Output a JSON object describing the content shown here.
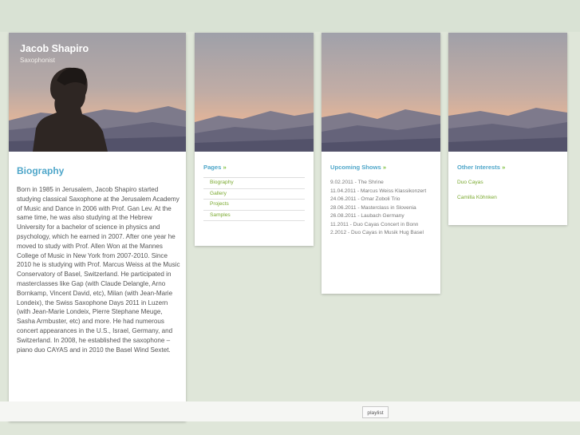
{
  "header": {
    "name": "Jacob Shapiro",
    "role": "Saxophonist"
  },
  "biography": {
    "title": "Biography",
    "text": "Born in 1985 in Jerusalem, Jacob Shapiro started studying classical Saxophone at the Jerusalem Academy of Music and Dance in 2006 with Prof. Gan Lev. At the same time, he was also studying at the Hebrew University for a bachelor of science in physics and psychology, which he earned in 2007. After one year he moved to study with Prof. Allen Won at the Mannes College of Music in New York from 2007-2010. Since 2010 he is studying with Prof. Marcus Weiss at the Music Conservatory of Basel, Switzerland. He participated in masterclasses like Gap (with Claude Delangle, Arno Bornkamp, Vincent David, etc), Milan (with Jean-Marie Londeix), the Swiss Saxophone Days 2011 in Luzern (with Jean-Marie Londeix, Pierre Stephane Meuge, Sasha Armbuster, etc) and more. He had numerous concert appearances in the U.S., Israel, Germany, and Switzerland. In 2008, he established the saxophone – piano duo CAYAS and in 2010 the Basel Wind Sextet."
  },
  "pages": {
    "title": "Pages",
    "arrow": "»",
    "items": [
      "Biography",
      "Gallery",
      "Projects",
      "Samples"
    ]
  },
  "shows": {
    "title": "Upcoming Shows",
    "arrow": "»",
    "items": [
      "9.02.2011 - The Shrine",
      "11.04.2011 - Marcus Weiss Klassikonzert",
      "24.06.2011 - Omar Zoboli Trio",
      "28.06.2011 - Masterclass in Slovenia",
      "26.08.2011 - Laubach Germany",
      "11.2011 - Duo Cayas Concert in Bonn",
      "2.2012 - Duo Cayas in Musik Hug Basel"
    ]
  },
  "interests": {
    "title": "Other Interests",
    "arrow": "»",
    "items": [
      "Duo Cayas",
      "Camilla Köhnken"
    ]
  },
  "footer": {
    "playlist_label": "playlist"
  }
}
